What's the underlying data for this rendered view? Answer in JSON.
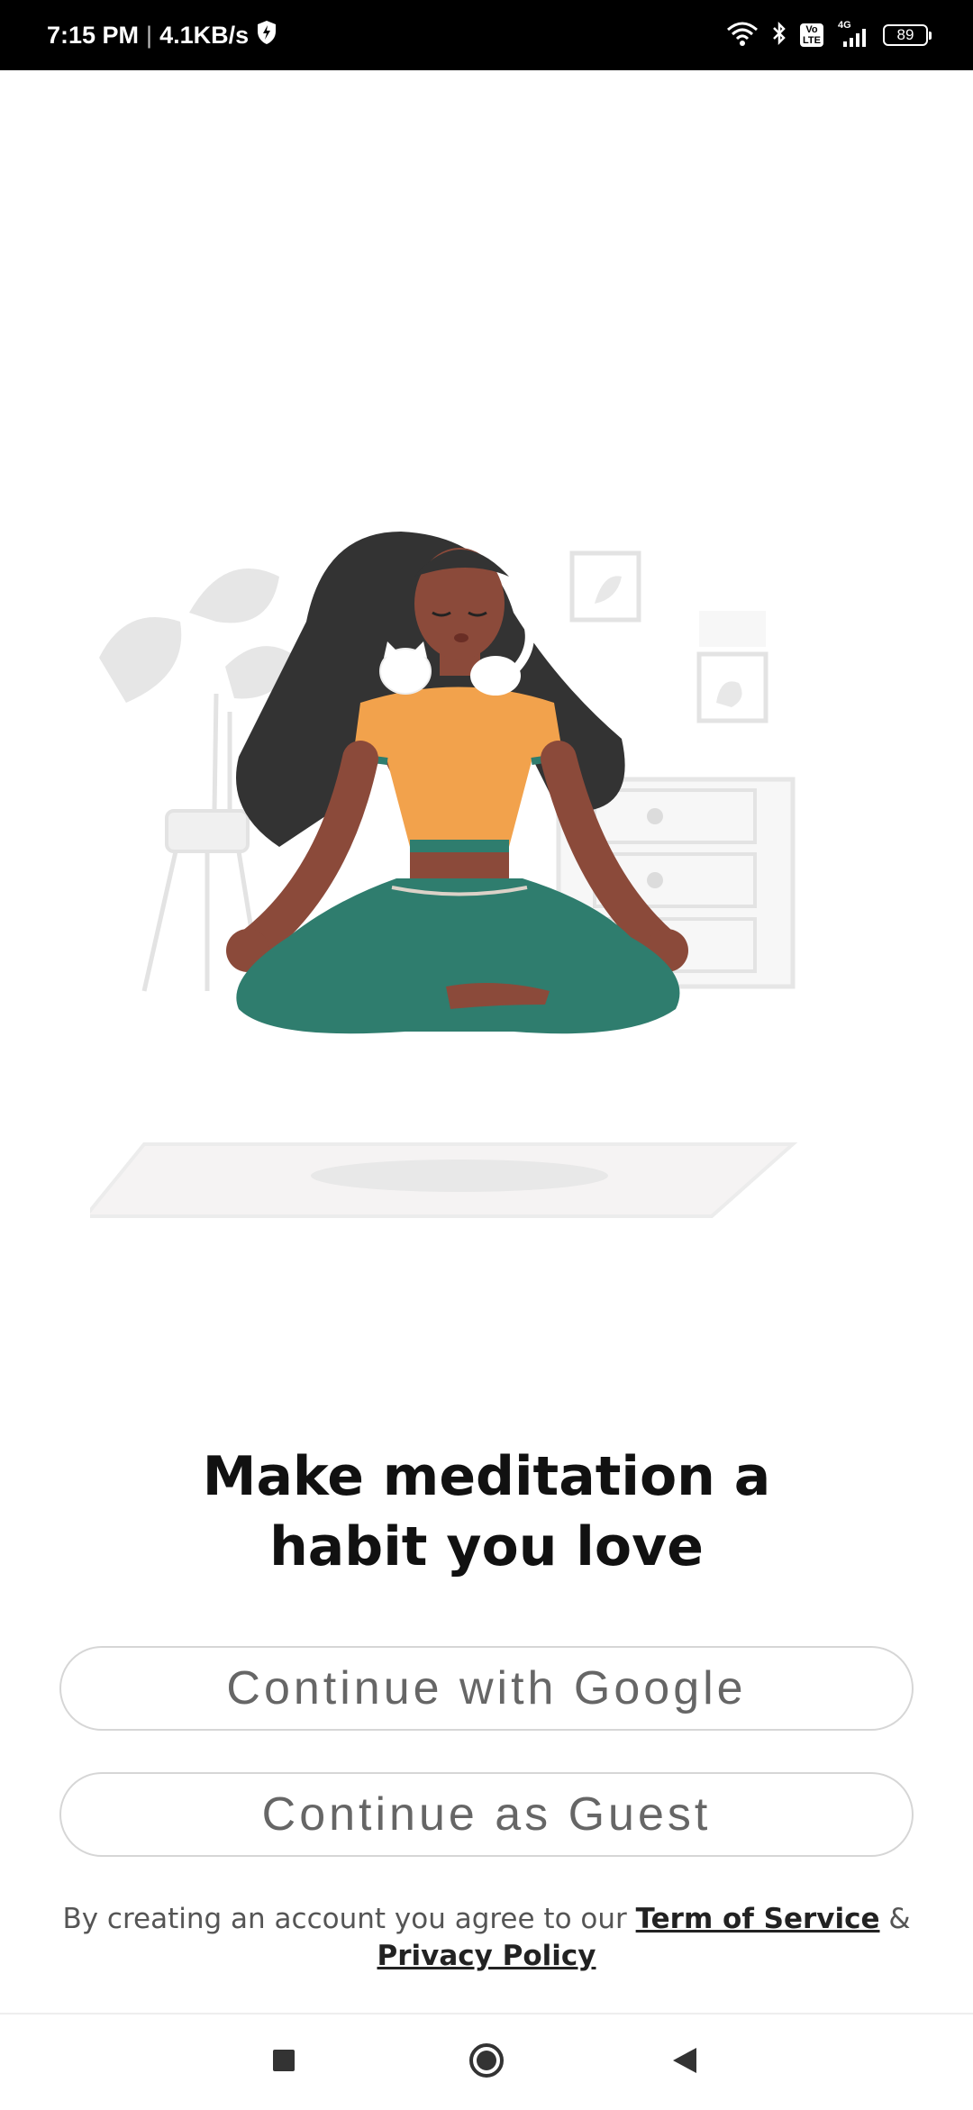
{
  "status_bar": {
    "time": "7:15 PM",
    "separator": "|",
    "speed": "4.1KB/s",
    "volte": "Vo LTE",
    "network": "4G",
    "battery": "89"
  },
  "onboarding": {
    "headline_line1": "Make meditation a",
    "headline_line2": "habit you love",
    "google_button": "Continue with Google",
    "guest_button": "Continue as Guest",
    "legal_prefix": "By creating an account you agree to our",
    "terms_link": "Term of Service",
    "amp": "&",
    "privacy_link": "Privacy Policy"
  },
  "colors": {
    "skin": "#8B4A3A",
    "hair": "#333333",
    "top": "#F2A24C",
    "pants": "#2F7D6E",
    "furniture": "#E6E6E6"
  }
}
